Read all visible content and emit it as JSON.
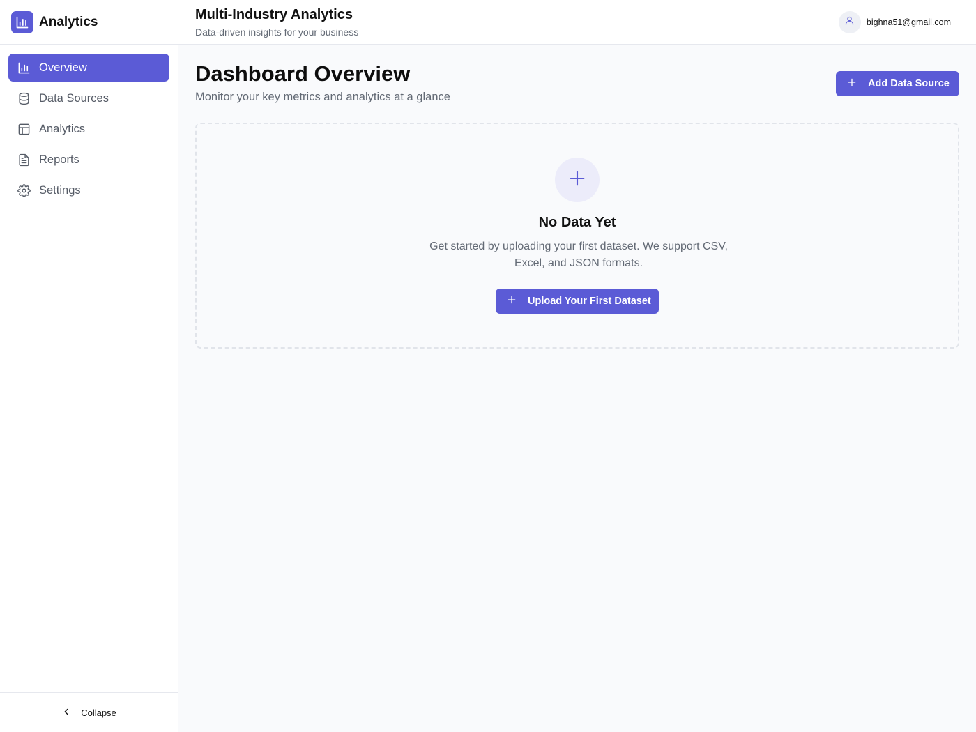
{
  "brand": {
    "name": "Analytics"
  },
  "sidebar": {
    "items": [
      {
        "label": "Overview",
        "icon": "bar-chart-icon",
        "active": true
      },
      {
        "label": "Data Sources",
        "icon": "database-icon",
        "active": false
      },
      {
        "label": "Analytics",
        "icon": "layout-icon",
        "active": false
      },
      {
        "label": "Reports",
        "icon": "file-text-icon",
        "active": false
      },
      {
        "label": "Settings",
        "icon": "gear-icon",
        "active": false
      }
    ],
    "collapse_label": "Collapse"
  },
  "header": {
    "title": "Multi-Industry Analytics",
    "subtitle": "Data-driven insights for your business",
    "user_email": "bighna51@gmail.com"
  },
  "main": {
    "title": "Dashboard Overview",
    "subtitle": "Monitor your key metrics and analytics at a glance",
    "add_button_label": "Add Data Source",
    "empty_state": {
      "title": "No Data Yet",
      "description": "Get started by uploading your first dataset. We support CSV, Excel, and JSON formats.",
      "button_label": "Upload Your First Dataset"
    }
  },
  "colors": {
    "accent": "#5b5bd6",
    "accent_light": "#ececfa",
    "background": "#f9fafc",
    "border": "#e6e8ee",
    "text_muted": "#636a75"
  }
}
